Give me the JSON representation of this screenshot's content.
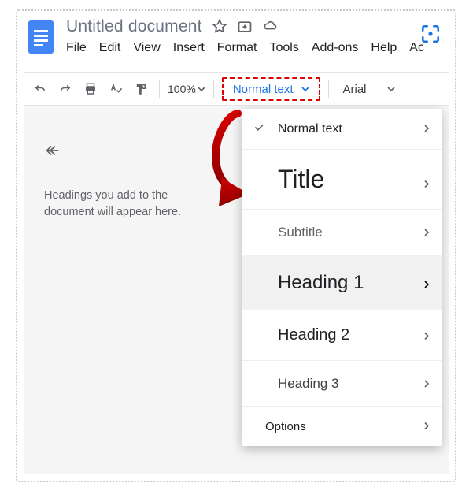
{
  "header": {
    "title": "Untitled document",
    "menus": [
      "File",
      "Edit",
      "View",
      "Insert",
      "Format",
      "Tools",
      "Add-ons",
      "Help",
      "Ac"
    ]
  },
  "toolbar": {
    "zoom": "100%",
    "styles_label": "Normal text",
    "font_label": "Arial"
  },
  "outline": {
    "placeholder": "Headings you add to the document will appear here."
  },
  "styles_menu": {
    "items": [
      {
        "label": "Normal text",
        "cls": "dd-normal",
        "checked": true
      },
      {
        "label": "Title",
        "cls": "dd-title"
      },
      {
        "label": "Subtitle",
        "cls": "dd-subtitle"
      },
      {
        "label": "Heading 1",
        "cls": "dd-h1",
        "active": true
      },
      {
        "label": "Heading 2",
        "cls": "dd-h2"
      },
      {
        "label": "Heading 3",
        "cls": "dd-h3"
      },
      {
        "label": "Options",
        "cls": "dd-options"
      }
    ]
  }
}
